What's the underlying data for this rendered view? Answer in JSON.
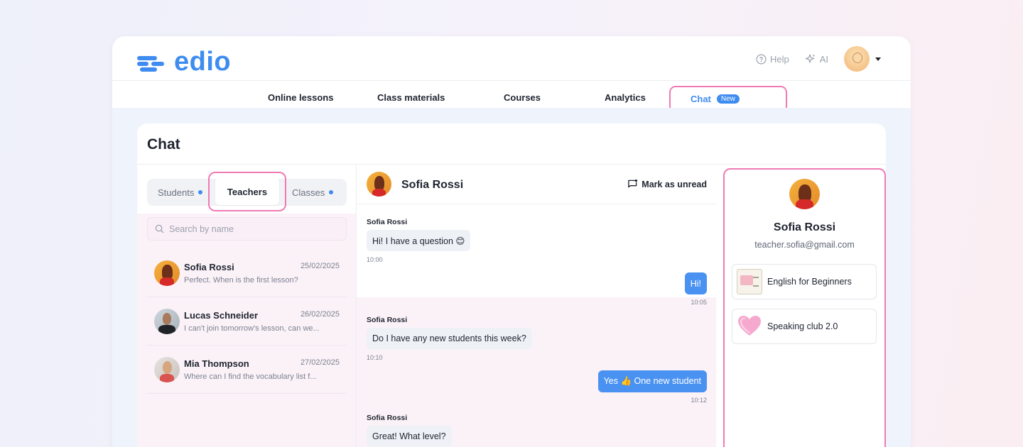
{
  "brand": {
    "name": "edio",
    "color": "#3f8cf0"
  },
  "header": {
    "help_label": "Help",
    "ai_label": "AI"
  },
  "nav": {
    "items": [
      {
        "label": "Online lessons"
      },
      {
        "label": "Class materials"
      },
      {
        "label": "Courses"
      },
      {
        "label": "Analytics"
      }
    ],
    "chat": {
      "label": "Chat",
      "badge": "New"
    }
  },
  "page": {
    "title": "Chat"
  },
  "tabs": {
    "students": "Students",
    "teachers": "Teachers",
    "classes": "Classes"
  },
  "search": {
    "placeholder": "Search by name"
  },
  "contacts": [
    {
      "name": "Sofia Rossi",
      "date": "25/02/2025",
      "preview": "Perfect. When is the first lesson?"
    },
    {
      "name": "Lucas Schneider",
      "date": "26/02/2025",
      "preview": "I can't join tomorrow's lesson, can we..."
    },
    {
      "name": "Mia Thompson",
      "date": "27/02/2025",
      "preview": "Where can I find the vocabulary list f..."
    }
  ],
  "conversation": {
    "name": "Sofia Rossi",
    "mark_unread_label": "Mark as unread",
    "messages": [
      {
        "direction": "in",
        "sender": "Sofia Rossi",
        "text": "Hi! I have a question 😊",
        "time": "10:00"
      },
      {
        "direction": "out",
        "text": "Hi!",
        "time": "10:05"
      },
      {
        "direction": "in",
        "sender": "Sofia Rossi",
        "text": "Do I have any new students this week?",
        "time": "10:10"
      },
      {
        "direction": "out",
        "text": "Yes 👍 One new student",
        "time": "10:12"
      },
      {
        "direction": "in",
        "sender": "Sofia Rossi",
        "text": "Great! What level?"
      }
    ]
  },
  "profile": {
    "name": "Sofia Rossi",
    "email": "teacher.sofia@gmail.com",
    "classes": [
      {
        "label": "English for Beginners",
        "icon": "book-icon"
      },
      {
        "label": "Speaking club 2.0",
        "icon": "heart-icon"
      }
    ]
  },
  "colors": {
    "accent": "#3f8cf0",
    "highlight": "#f07ab4",
    "unread_dot": "#3f8cf0"
  }
}
